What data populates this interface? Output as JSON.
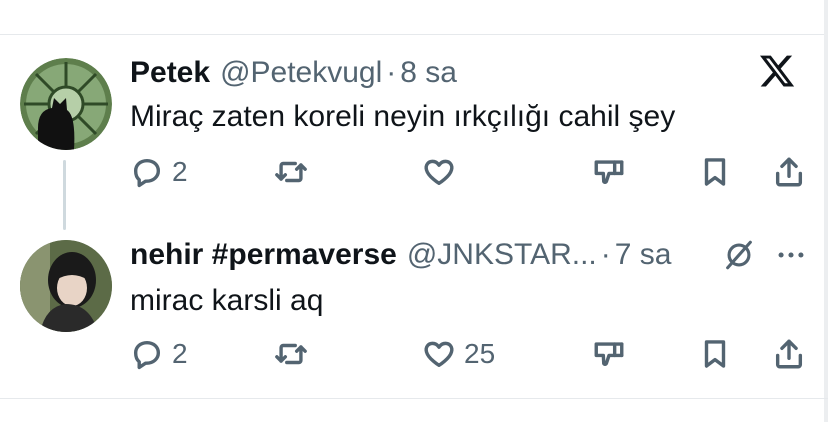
{
  "tweets": [
    {
      "name": "Petek",
      "handle": "@Petekvugl",
      "separator": "·",
      "time": "8 sa",
      "text": "Miraç zaten koreli neyin ırkçılığı cahil şey",
      "replies": "2",
      "retweets": "",
      "likes": ""
    },
    {
      "name": "nehir #permaverse",
      "handle": "@JNKSTAR...",
      "separator": "·",
      "time": "7 sa",
      "text": "mirac karsli aq",
      "replies": "2",
      "retweets": "",
      "likes": "25"
    }
  ],
  "colors": {
    "text_primary": "#0f1419",
    "text_secondary": "#536471",
    "divider": "#e6e9ec",
    "thread_line": "#cfd9de"
  },
  "icons": [
    "x-logo-icon",
    "reply-icon",
    "retweet-icon",
    "like-icon",
    "dislike-icon",
    "bookmark-icon",
    "share-icon",
    "grok-icon",
    "more-icon"
  ]
}
